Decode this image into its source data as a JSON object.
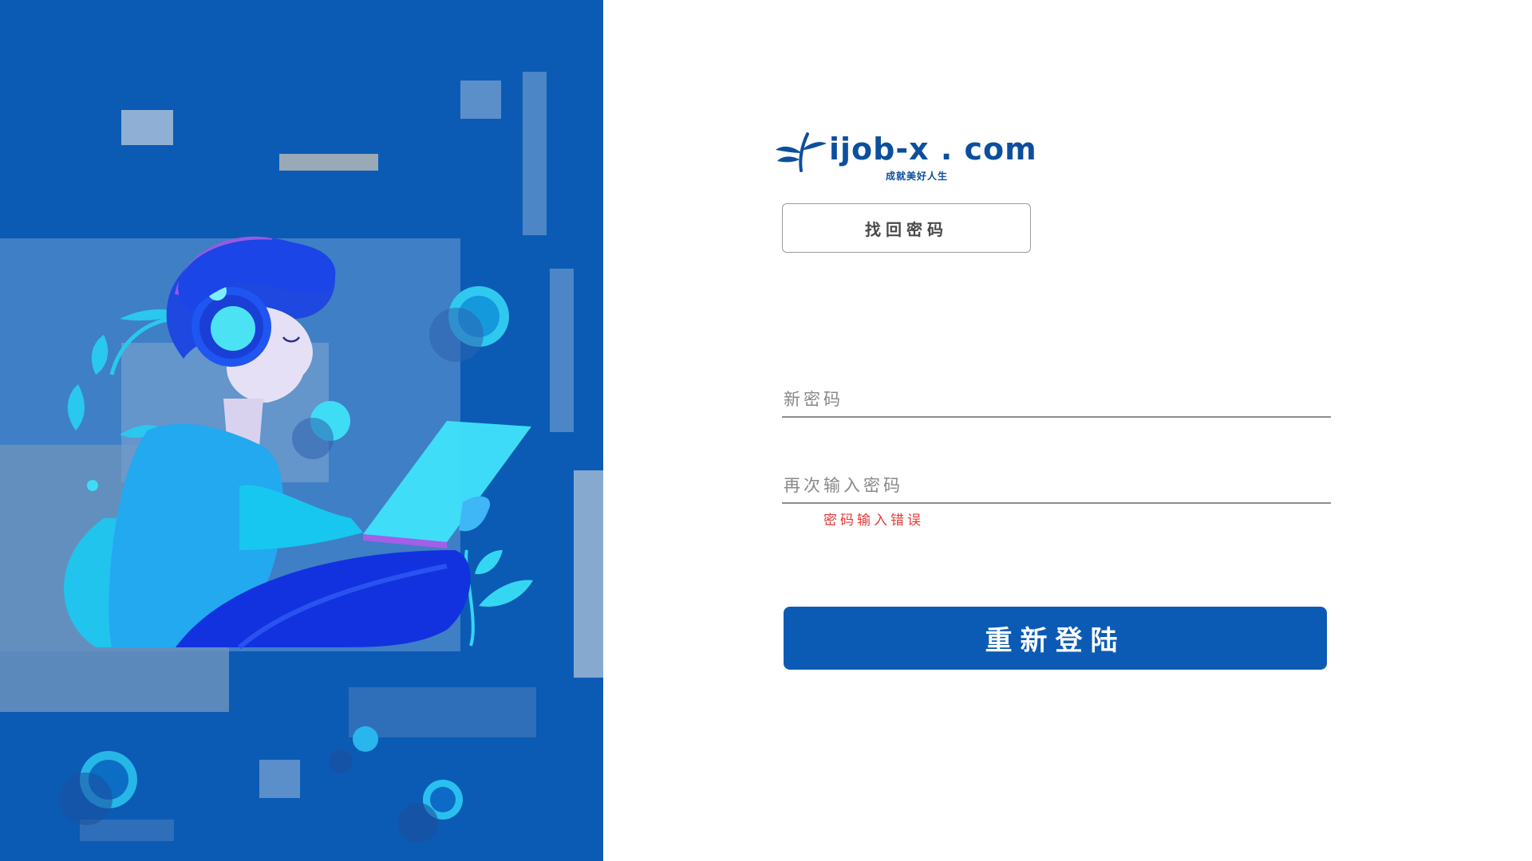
{
  "brand": {
    "logo_text": "ijob-x . com",
    "tagline": "成就美好人生",
    "logo_icon": "sprout-icon",
    "color": "#0c4f9e"
  },
  "form": {
    "title": "找回密码",
    "new_password": {
      "placeholder": "新密码",
      "value": ""
    },
    "confirm_password": {
      "placeholder": "再次输入密码",
      "value": ""
    },
    "error_message": "密码输入错误",
    "submit_label": "重新登陆"
  },
  "theme": {
    "primary": "#0b5bb5",
    "error": "#e53935",
    "panel_background": "#0b5bb5"
  },
  "illustration": {
    "icon": "person-with-headphones-and-tablet-illustration"
  }
}
